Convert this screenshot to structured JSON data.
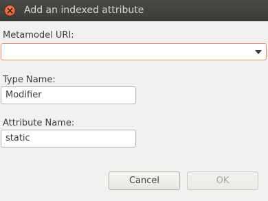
{
  "window": {
    "title": "Add an indexed attribute"
  },
  "form": {
    "metamodel_label": "Metamodel URI:",
    "metamodel_value": "",
    "type_name_label": "Type Name:",
    "type_name_value": "Modifier",
    "attribute_name_label": "Attribute Name:",
    "attribute_name_value": "static"
  },
  "buttons": {
    "cancel_label": "Cancel",
    "ok_label": "OK"
  },
  "icons": {
    "close": "close-icon",
    "dropdown": "chevron-down-icon"
  },
  "colors": {
    "titlebar": "#3c3b37",
    "close_button": "#e2562b",
    "focus_border": "#e8906a",
    "window_background": "#f2f1f0"
  }
}
